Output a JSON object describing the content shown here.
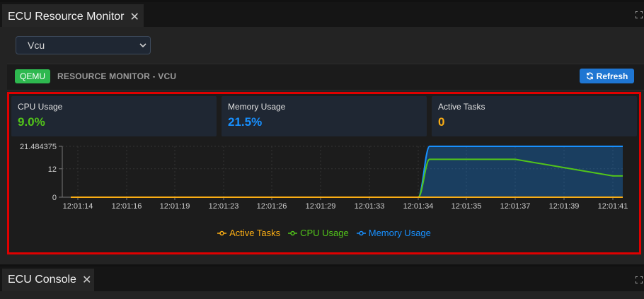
{
  "top_tab": {
    "title": "ECU Resource Monitor",
    "close": "✕"
  },
  "selector": {
    "value": "Vcu"
  },
  "monitor": {
    "badge": "QEMU",
    "title": "RESOURCE MONITOR - VCU",
    "refresh_label": "Refresh"
  },
  "stats": [
    {
      "label": "CPU Usage",
      "value": "9.0%",
      "color": "#52c41a"
    },
    {
      "label": "Memory Usage",
      "value": "21.5%",
      "color": "#1890ff"
    },
    {
      "label": "Active Tasks",
      "value": "0",
      "color": "#faad14"
    }
  ],
  "chart_data": {
    "type": "line",
    "x": [
      "12:01:14",
      "12:01:16",
      "12:01:19",
      "12:01:23",
      "12:01:26",
      "12:01:29",
      "12:01:33",
      "12:01:34",
      "12:01:35",
      "12:01:37",
      "12:01:39",
      "12:01:41"
    ],
    "y_ticks": [
      "0",
      "12",
      "21.484375"
    ],
    "ylim": [
      0,
      21.484375
    ],
    "grid": true,
    "legend_position": "bottom",
    "series": [
      {
        "name": "Active Tasks",
        "color": "#faad14",
        "area": false,
        "values": [
          0,
          0,
          0,
          0,
          0,
          0,
          0,
          0,
          0,
          0,
          0,
          0
        ]
      },
      {
        "name": "CPU Usage",
        "color": "#52c41a",
        "area": false,
        "values": [
          0,
          0,
          0,
          0,
          0,
          0,
          0,
          0,
          16,
          16,
          12.5,
          9
        ]
      },
      {
        "name": "Memory Usage",
        "color": "#1890ff",
        "area": true,
        "values": [
          0,
          0,
          0,
          0,
          0,
          0,
          0,
          0,
          21.5,
          21.5,
          21.5,
          21.5
        ]
      }
    ]
  },
  "bottom_tab": {
    "title": "ECU Console",
    "close": "✕"
  }
}
